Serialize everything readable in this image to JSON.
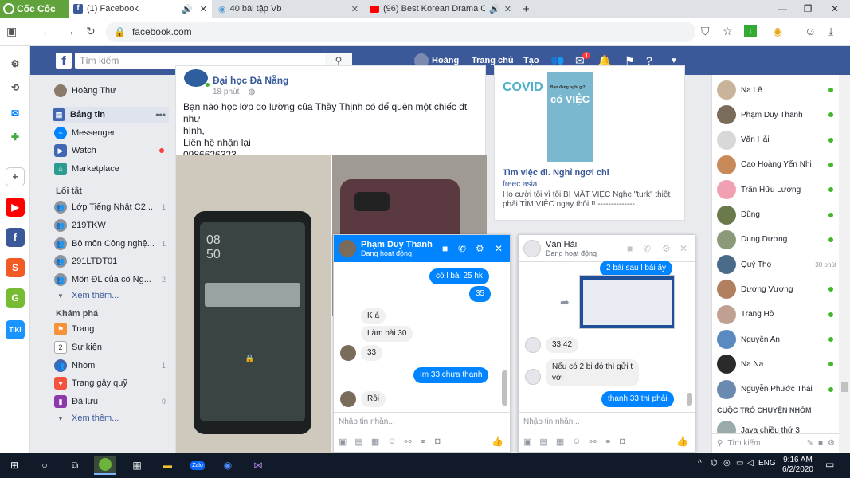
{
  "browser": {
    "brand": "Cốc Cốc",
    "tabs": [
      {
        "title": "(1) Facebook",
        "icon": "facebook-icon",
        "audio": true,
        "active": true
      },
      {
        "title": "40 bài tập Vb",
        "icon": "chat-icon",
        "audio": false,
        "active": false
      },
      {
        "title": "(96) Best Korean Drama OST P",
        "icon": "youtube-icon",
        "audio": true,
        "active": false
      }
    ],
    "new_tab": "+",
    "url": "facebook.com"
  },
  "fb_header": {
    "search_placeholder": "Tìm kiếm",
    "profile_name": "Hoàng",
    "home": "Trang chủ",
    "create": "Tạo",
    "messenger_badge": "1"
  },
  "left_nav": {
    "profile_name": "Hoàng Thư",
    "main_items": [
      {
        "label": "Bảng tin",
        "color": "#4267b2",
        "selected": true
      },
      {
        "label": "Messenger",
        "color": "#0084ff"
      },
      {
        "label": "Watch",
        "color": "#4267b2",
        "dot": true
      },
      {
        "label": "Marketplace",
        "color": "#2b9c8f"
      }
    ],
    "shortcuts_title": "Lối tắt",
    "shortcuts": [
      {
        "label": "Lớp Tiếng Nhật C2...",
        "count": "1"
      },
      {
        "label": "219TKW",
        "count": ""
      },
      {
        "label": "Bộ môn Công nghệ...",
        "count": "1"
      },
      {
        "label": "291LTDT01",
        "count": ""
      },
      {
        "label": "Môn ĐL của cô Ng...",
        "count": "2"
      }
    ],
    "see_more": "Xem thêm...",
    "explore_title": "Khám phá",
    "explore": [
      {
        "label": "Trang",
        "color": "#f7923b",
        "count": ""
      },
      {
        "label": "Sự kiện",
        "color": "#e9ebee",
        "count": ""
      },
      {
        "label": "Nhóm",
        "color": "#4267b2",
        "count": "1"
      },
      {
        "label": "Trang gây quỹ",
        "color": "#f5533d",
        "count": ""
      },
      {
        "label": "Đã lưu",
        "color": "#8c3aab",
        "count": "9"
      }
    ],
    "see_more_2": "Xem thêm..."
  },
  "post": {
    "author": "Đại học Đà Nẵng",
    "time": "18 phút",
    "text_line1": "Bạn nào học lớp đo lường của Thầy Thịnh có để quên một chiếc đt như",
    "text_line2": "hình,",
    "text_line3": "Liên hệ nhận lại",
    "text_line4": "0986626323",
    "phone_time1": "08",
    "phone_time2": "50"
  },
  "ad": {
    "title": "Tìm việc đi. Nghỉ ngơi chi",
    "domain": "freec.asia",
    "desc": "Ho cười tôi vì tôi BỊ MẤT VIỆC Nghe \"turk\" thiệt phải TÌM VIỆC ngay thôi !! --------------...",
    "img_text1": "COVID",
    "img_text2": "có VIỆC",
    "img_small": "Bạn đang nghỉ gì?"
  },
  "chat1": {
    "name": "Phạm Duy Thanh",
    "status": "Đang hoạt động",
    "messages": [
      {
        "text": "có l bài 25 hk",
        "side": "out"
      },
      {
        "text": "35",
        "side": "out"
      },
      {
        "text": "K á",
        "side": "in"
      },
      {
        "text": "Làm bài 30",
        "side": "in"
      },
      {
        "text": "33",
        "side": "in"
      },
      {
        "text": "Im 33 chưa thanh",
        "side": "out"
      },
      {
        "text": "Rồi",
        "side": "in"
      }
    ],
    "input_placeholder": "Nhập tin nhắn..."
  },
  "chat2": {
    "name": "Văn Hải",
    "status": "Đang hoạt động",
    "messages": [
      {
        "text": "2 bài sau l bài ấy",
        "side": "out"
      },
      {
        "text": "33 42",
        "side": "in"
      },
      {
        "text": "Nếu có 2 bi đó thì gửi t",
        "side": "in"
      },
      {
        "text": "với",
        "side": "in"
      },
      {
        "text": "thanh 33 thì phải",
        "side": "out"
      }
    ],
    "input_placeholder": "Nhập tin nhắn..."
  },
  "contacts": [
    {
      "name": "Na Lê",
      "color": "#c9b39a",
      "online": true
    },
    {
      "name": "Phạm Duy Thanh",
      "color": "#7b6b5a",
      "online": true
    },
    {
      "name": "Văn Hải",
      "color": "#d8d8d8",
      "online": true
    },
    {
      "name": "Cao Hoàng Yến Nhi",
      "color": "#c98a5a",
      "online": true
    },
    {
      "name": "Trần Hữu Lương",
      "color": "#f0a0b0",
      "online": true
    },
    {
      "name": "Dũng",
      "color": "#6a7a4a",
      "online": true
    },
    {
      "name": "Dung Dương",
      "color": "#8a9a7a",
      "online": true
    },
    {
      "name": "Quý Thọ",
      "color": "#4a6a8a",
      "online": false,
      "time": "30 phút"
    },
    {
      "name": "Dương Vương",
      "color": "#b08060",
      "online": true
    },
    {
      "name": "Trang Hồ",
      "color": "#c0a090",
      "online": true
    },
    {
      "name": "Nguyễn An",
      "color": "#5a8ac0",
      "online": true
    },
    {
      "name": "Na Na",
      "color": "#2a2a2a",
      "online": true
    },
    {
      "name": "Nguyễn Phước Thái",
      "color": "#6a8ab0",
      "online": true
    }
  ],
  "group_chats_title": "CUỘC TRÒ CHUYỆN NHÓM",
  "group_chat": "Java chiều thứ 3",
  "contact_search": "Tìm kiếm",
  "taskbar": {
    "time": "9:16 AM",
    "date": "6/2/2020",
    "lang": "ENG"
  }
}
